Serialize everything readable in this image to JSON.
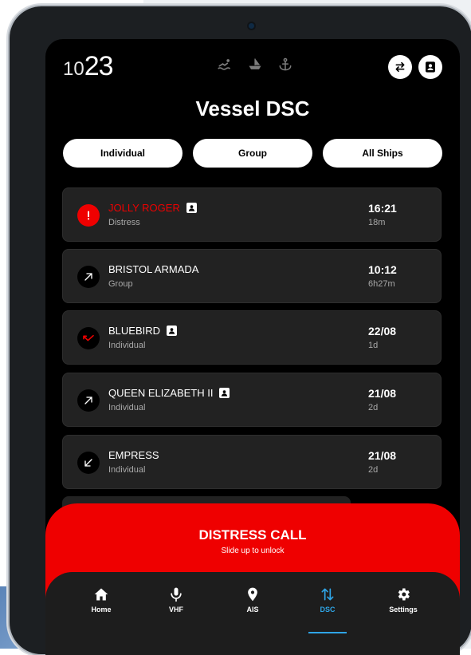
{
  "clock": {
    "hour": "10",
    "minute": "23"
  },
  "status_icons": [
    "swimmer-icon",
    "boat-icon",
    "anchor-icon"
  ],
  "header": {
    "title": "Vessel DSC",
    "icons": [
      "sliders-icon",
      "contact-icon"
    ]
  },
  "filters": [
    "Individual",
    "Group",
    "All Ships"
  ],
  "calls": [
    {
      "name": "JOLLY ROGER",
      "type": "Distress",
      "time": "16:21",
      "ago": "18m",
      "icon": "alert-icon",
      "contact": true,
      "alert": true
    },
    {
      "name": "BRISTOL ARMADA",
      "type": "Group",
      "time": "10:12",
      "ago": "6h27m",
      "icon": "outgoing-arrow-icon",
      "contact": false
    },
    {
      "name": "BLUEBIRD",
      "type": "Individual",
      "time": "22/08",
      "ago": "1d",
      "icon": "missed-call-icon",
      "contact": true
    },
    {
      "name": "QUEEN ELIZABETH II",
      "type": "Individual",
      "time": "21/08",
      "ago": "2d",
      "icon": "outgoing-arrow-icon",
      "contact": true
    },
    {
      "name": "EMPRESS",
      "type": "Individual",
      "time": "21/08",
      "ago": "2d",
      "icon": "incoming-arrow-icon",
      "contact": false
    }
  ],
  "distress": {
    "title": "DISTRESS CALL",
    "subtitle": "Slide up to unlock"
  },
  "nav": [
    {
      "label": "Home",
      "icon": "home-icon"
    },
    {
      "label": "VHF",
      "icon": "microphone-icon"
    },
    {
      "label": "AIS",
      "icon": "location-pin-icon"
    },
    {
      "label": "DSC",
      "icon": "transfer-arrows-icon",
      "active": true
    },
    {
      "label": "Settings",
      "icon": "gear-icon"
    }
  ],
  "colors": {
    "alert": "#ef0000",
    "accent": "#2fa5e6",
    "card": "#222222"
  }
}
